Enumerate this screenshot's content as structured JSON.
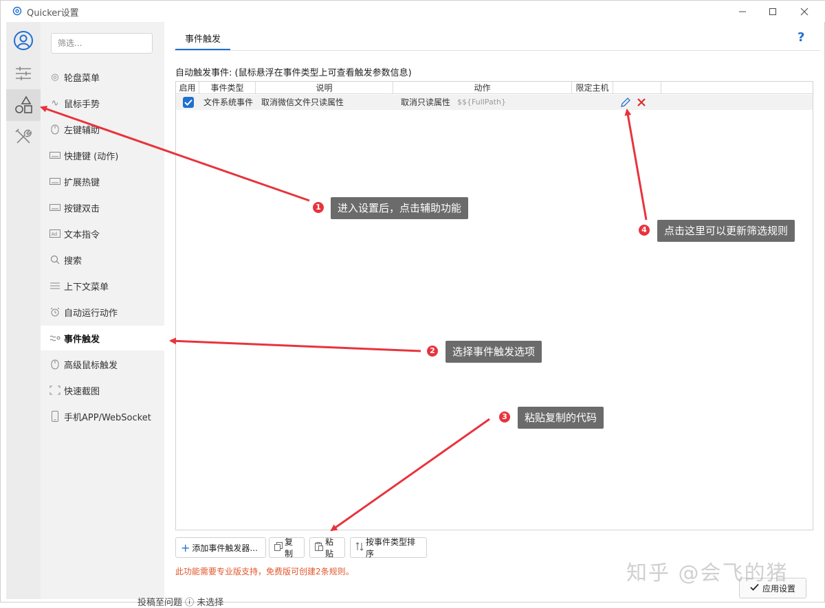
{
  "window": {
    "title": "Quicker设置"
  },
  "sidebar": {
    "filter_placeholder": "筛选...",
    "items": [
      {
        "label": "轮盘菜单",
        "icon": "wheel-icon"
      },
      {
        "label": "鼠标手势",
        "icon": "gesture-icon"
      },
      {
        "label": "左键辅助",
        "icon": "mouse-icon"
      },
      {
        "label": "快捷键 (动作)",
        "icon": "keyboard-icon"
      },
      {
        "label": "扩展热键",
        "icon": "keyboard-icon"
      },
      {
        "label": "按键双击",
        "icon": "keyboard-icon"
      },
      {
        "label": "文本指令",
        "icon": "text-command-icon"
      },
      {
        "label": "搜索",
        "icon": "search-icon"
      },
      {
        "label": "上下文菜单",
        "icon": "menu-lines-icon"
      },
      {
        "label": "自动运行动作",
        "icon": "alarm-clock-icon"
      },
      {
        "label": "事件触发",
        "icon": "event-trigger-icon"
      },
      {
        "label": "高级鼠标触发",
        "icon": "mouse-icon"
      },
      {
        "label": "快速截图",
        "icon": "screenshot-icon"
      },
      {
        "label": "手机APP/WebSocket",
        "icon": "phone-icon"
      }
    ]
  },
  "main": {
    "tab_label": "事件触发",
    "help_label": "?",
    "section_label": "自动触发事件:  (鼠标悬浮在事件类型上可查看触发参数信息)",
    "table": {
      "columns": [
        "启用",
        "事件类型",
        "说明",
        "动作",
        "限定主机"
      ],
      "rows": [
        {
          "enabled": true,
          "event_type": "文件系统事件",
          "description": "取消微信文件只读属性",
          "action": "取消只读属性",
          "action_param": "$${FullPath}",
          "host": ""
        }
      ]
    },
    "buttons": {
      "add": "添加事件触发器...",
      "copy": "复制",
      "paste": "粘贴",
      "sort": "按事件类型排序"
    },
    "warning": "此功能需要专业版支持，免费版可创建2条规则。",
    "apply": "应用设置"
  },
  "annotations": [
    {
      "number": "1",
      "text": "进入设置后，点击辅助功能"
    },
    {
      "number": "2",
      "text": "选择事件触发选项"
    },
    {
      "number": "3",
      "text": "粘贴复制的代码"
    },
    {
      "number": "4",
      "text": "点击这里可以更新筛选规则"
    }
  ],
  "watermark": "知乎 @会飞的猪",
  "bottom_strip": "投稿至问题 ⓘ   未选择"
}
